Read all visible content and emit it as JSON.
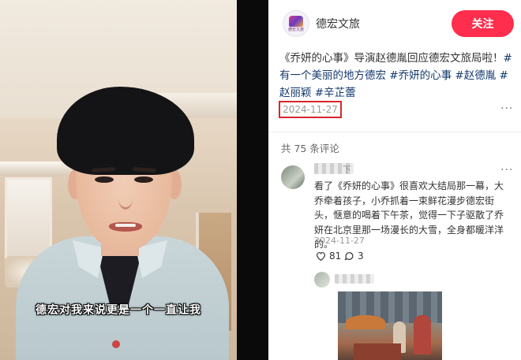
{
  "video": {
    "subtitle": "德宏对我来说更是一个一直让我"
  },
  "header": {
    "avatar_mini_text": "德宏文旅",
    "author_name": "德宏文旅",
    "follow_label": "关注"
  },
  "note": {
    "title_text": "《乔妍的心事》导演赵德胤回应德宏文旅局啦！",
    "tags": [
      "#有一个美丽的地方德宏",
      "#乔妍的心事",
      "#赵德胤",
      "#赵丽颖",
      "#辛芷蕾"
    ],
    "date": "2024-11-27",
    "more_icon": "more-dots-icon"
  },
  "comments_section": {
    "count_label": "共 75 条评论"
  },
  "comments": [
    {
      "name_suffix": "下",
      "text": "看了《乔妍的心事》很喜欢大结局那一幕，大乔牵着孩子，小乔抓着一束鲜花漫步德宏街头，惬意的喝着下午茶，觉得一下子驱散了乔妍在北京里那一场漫长的大雪，全身都暖洋洋的。",
      "date": "2024-11-27",
      "likes": "81",
      "replies": "3"
    }
  ],
  "colors": {
    "follow_bg": "#ff2e4d",
    "tag": "#13386c",
    "highlight_box": "#d9262c"
  }
}
